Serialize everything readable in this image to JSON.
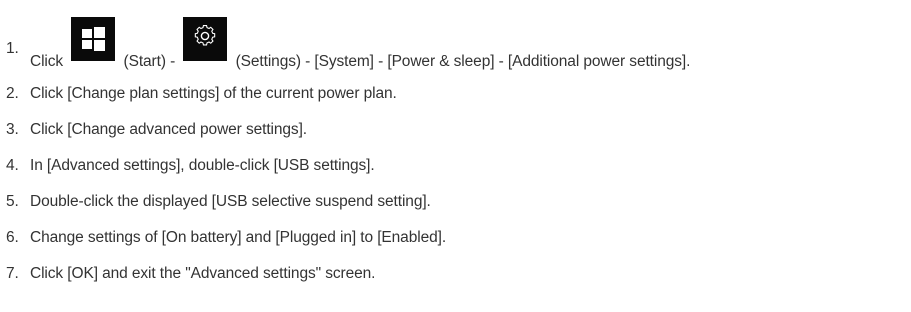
{
  "steps": [
    {
      "number": "1.",
      "parts": {
        "click": "Click",
        "start_label": "(Start) -",
        "settings_label": "(Settings) - [System] - [Power & sleep] - [Additional power settings]."
      },
      "icons": [
        "windows-start-icon",
        "settings-gear-icon"
      ]
    },
    {
      "number": "2.",
      "text": "Click [Change plan settings] of the current power plan."
    },
    {
      "number": "3.",
      "text": "Click [Change advanced power settings]."
    },
    {
      "number": "4.",
      "text": "In [Advanced settings], double-click [USB settings]."
    },
    {
      "number": "5.",
      "text": "Double-click the displayed [USB selective suspend setting]."
    },
    {
      "number": "6.",
      "text": "Change settings of [On battery] and [Plugged in] to [Enabled]."
    },
    {
      "number": "7.",
      "text": "Click [OK] and exit the \"Advanced settings\" screen."
    }
  ],
  "colors": {
    "text": "#333333",
    "icon_background": "#0a0a0a",
    "icon_foreground": "#ffffff"
  }
}
